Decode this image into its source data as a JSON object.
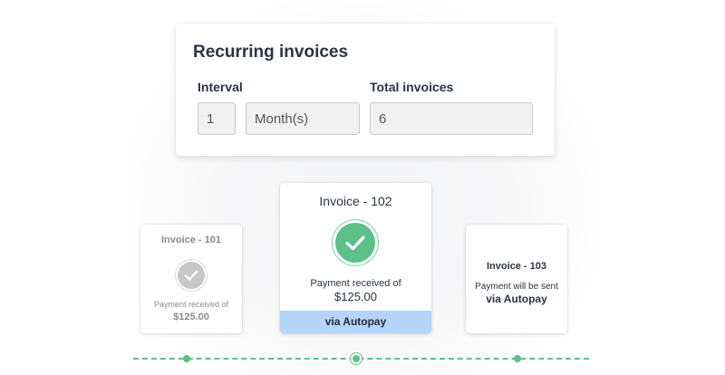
{
  "recurring": {
    "title": "Recurring invoices",
    "interval_label": "Interval",
    "interval_value": "1",
    "interval_unit": "Month(s)",
    "total_label": "Total invoices",
    "total_value": "6"
  },
  "invoices": [
    {
      "title": "Invoice - 101",
      "status": "Payment received of",
      "amount": "$125.00",
      "icon": "check-icon"
    },
    {
      "title": "Invoice - 102",
      "status": "Payment received of",
      "amount": "$125.00",
      "icon": "check-icon",
      "footer": "via Autopay"
    },
    {
      "title": "Invoice - 103",
      "status": "Payment will be sent",
      "method": "via Autopay"
    }
  ],
  "colors": {
    "success_green": "#5cc08a",
    "inactive_grey": "#c7c7c7",
    "autopay_blue": "#b5d4f9",
    "heading_text": "#2b3445"
  }
}
